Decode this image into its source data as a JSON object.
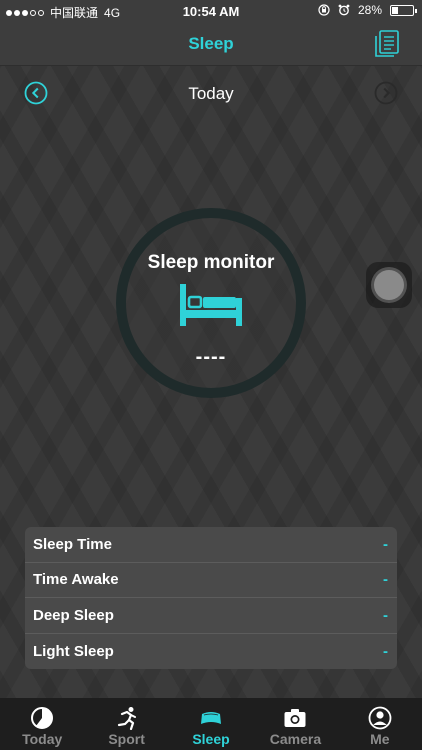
{
  "status_bar": {
    "carrier": "中国联通",
    "network": "4G",
    "time": "10:54 AM",
    "battery": "28%",
    "battery_level": 0.28
  },
  "nav": {
    "title": "Sleep",
    "right_icon": "sleep-record-icon"
  },
  "date": {
    "label": "Today",
    "prev_icon": "chevron-left-circle-icon",
    "next_icon": "chevron-right-circle-icon"
  },
  "monitor": {
    "title": "Sleep monitor",
    "value": "----",
    "icon": "bed-icon"
  },
  "stats": [
    {
      "label": "Sleep Time",
      "value": "-"
    },
    {
      "label": "Time Awake",
      "value": "-"
    },
    {
      "label": "Deep Sleep",
      "value": "-"
    },
    {
      "label": "Light Sleep",
      "value": "-"
    }
  ],
  "tabs": [
    {
      "label": "Today",
      "icon": "pie-chart-icon",
      "active": false
    },
    {
      "label": "Sport",
      "icon": "runner-icon",
      "active": false
    },
    {
      "label": "Sleep",
      "icon": "pillow-icon",
      "active": true
    },
    {
      "label": "Camera",
      "icon": "camera-icon",
      "active": false
    },
    {
      "label": "Me",
      "icon": "user-icon",
      "active": false
    }
  ],
  "colors": {
    "accent": "#2fd2d8",
    "background": "#3a3a3a",
    "tabbar": "#1e1e1e",
    "inactive_tab": "#8c8c8c"
  }
}
